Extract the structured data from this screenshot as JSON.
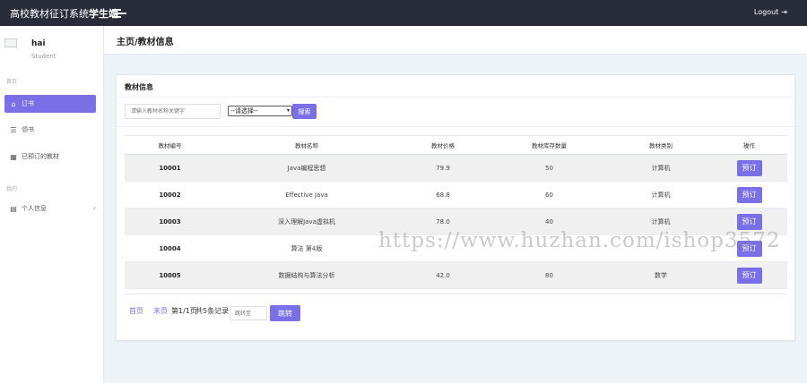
{
  "header": {
    "brand_prefix": "高校教材征订系统",
    "brand_suffix": "学生端",
    "logout_label": "Logout",
    "logout_icon": "logout-icon"
  },
  "sidebar": {
    "user_name": "hai",
    "user_role": "Student",
    "section_home": "首页",
    "section_mine": "我的",
    "items": [
      {
        "label": "订书",
        "icon": "home-icon",
        "active": true
      },
      {
        "label": "领书",
        "icon": "book-icon",
        "active": false
      },
      {
        "label": "已预订的教材",
        "icon": "grid-icon",
        "active": false
      },
      {
        "label": "个人信息",
        "icon": "profile-icon",
        "active": false
      }
    ]
  },
  "page": {
    "breadcrumb": "主页/教材信息"
  },
  "card": {
    "title": "教材信息",
    "search_placeholder": "请输入教材名称关键字",
    "select_value": "--请选择--",
    "search_button": "搜索"
  },
  "table": {
    "headers": [
      "教材编号",
      "教材名称",
      "教材价格",
      "教材库存数量",
      "教材类别",
      "操作"
    ],
    "rows": [
      {
        "code": "10001",
        "name": "Java编程思想",
        "price": "79.9",
        "stock": "50",
        "category": "计算机",
        "action": "预订"
      },
      {
        "code": "10002",
        "name": "Effective Java",
        "price": "68.8",
        "stock": "60",
        "category": "计算机",
        "action": "预订"
      },
      {
        "code": "10003",
        "name": "深入理解Java虚拟机",
        "price": "78.0",
        "stock": "40",
        "category": "计算机",
        "action": "预订"
      },
      {
        "code": "10004",
        "name": "算法 第4版",
        "price": "",
        "stock": "",
        "category": "",
        "action": "预订"
      },
      {
        "code": "10005",
        "name": "数据结构与算法分析",
        "price": "42.0",
        "stock": "80",
        "category": "数学",
        "action": "预订"
      }
    ]
  },
  "pager": {
    "first": "首页",
    "last": "末页",
    "page_info": "第1/1页",
    "record_info": "共5条记录",
    "jump_placeholder": "跳转至",
    "jump_button": "跳转"
  },
  "watermark": "https://www.huzhan.com/ishop3572",
  "colors": {
    "topbar": "#272c38",
    "accent": "#7a6fe6",
    "background": "#eef3f7"
  }
}
